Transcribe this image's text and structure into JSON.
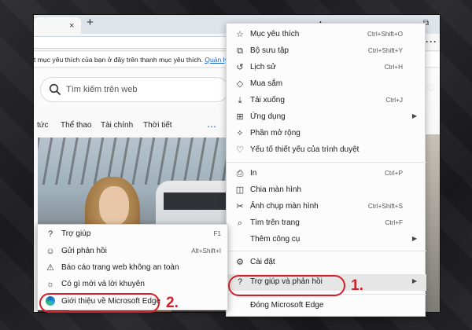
{
  "tabbar": {
    "close_icon": "×",
    "new_tab_icon": "+",
    "window_icon": "⧉"
  },
  "favbar": {
    "text": "t mục yêu thích của bạn ở đây trên thanh mục yêu thích.",
    "link": "Quản lý"
  },
  "search": {
    "placeholder": "Tìm kiếm trên web"
  },
  "news": {
    "tabs": [
      "tức",
      "Thể thao",
      "Tài chính",
      "Thời tiết"
    ],
    "more": "⋯"
  },
  "menu": {
    "items": [
      {
        "label": "Mục yêu thích",
        "shortcut": "Ctrl+Shift+O",
        "icon": "favorites-icon"
      },
      {
        "label": "Bộ sưu tập",
        "shortcut": "Ctrl+Shift+Y",
        "icon": "collections-icon"
      },
      {
        "label": "Lịch sử",
        "shortcut": "Ctrl+H",
        "icon": "history-icon"
      },
      {
        "label": "Mua sắm",
        "shortcut": "",
        "icon": "shopping-icon"
      },
      {
        "label": "Tải xuống",
        "shortcut": "Ctrl+J",
        "icon": "download-icon"
      },
      {
        "label": "Ứng dụng",
        "shortcut": "",
        "icon": "apps-icon",
        "submenu": true
      },
      {
        "label": "Phần mở rộng",
        "shortcut": "",
        "icon": "extensions-icon"
      },
      {
        "label": "Yếu tố thiết yếu của trình duyệt",
        "shortcut": "",
        "icon": "essentials-icon"
      },
      {
        "label": "In",
        "shortcut": "Ctrl+P",
        "icon": "print-icon"
      },
      {
        "label": "Chia màn hình",
        "shortcut": "",
        "icon": "split-screen-icon"
      },
      {
        "label": "Ảnh chụp màn hình",
        "shortcut": "Ctrl+Shift+S",
        "icon": "screenshot-icon"
      },
      {
        "label": "Tìm trên trang",
        "shortcut": "Ctrl+F",
        "icon": "find-icon"
      },
      {
        "label": "Thêm công cụ",
        "shortcut": "",
        "icon": "",
        "submenu": true
      },
      {
        "label": "Cài đặt",
        "shortcut": "",
        "icon": "settings-icon"
      },
      {
        "label": "Trợ giúp và phản hồi",
        "shortcut": "",
        "icon": "help-icon",
        "submenu": true
      },
      {
        "label": "Đóng Microsoft Edge",
        "shortcut": "",
        "icon": ""
      }
    ]
  },
  "submenu": {
    "items": [
      {
        "label": "Trợ giúp",
        "shortcut": "F1",
        "icon": "help-icon"
      },
      {
        "label": "Gửi phản hồi",
        "shortcut": "Alt+Shift+I",
        "icon": "feedback-icon"
      },
      {
        "label": "Báo cáo trang web không an toàn",
        "shortcut": "",
        "icon": "warning-icon"
      },
      {
        "label": "Có gì mới và lời khuyên",
        "shortcut": "",
        "icon": "tips-icon"
      },
      {
        "label": "Giới thiệu về Microsoft Edge",
        "shortcut": "",
        "icon": "edge-logo-icon"
      }
    ]
  },
  "annotations": {
    "one": "1.",
    "two": "2."
  },
  "colors": {
    "annotation": "#d2202a",
    "link": "#1a66c8"
  }
}
